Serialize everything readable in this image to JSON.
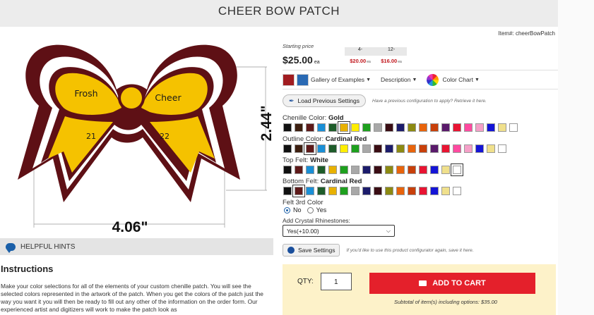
{
  "page_title": "CHEER BOW PATCH",
  "item_number": "Item#: cheerBowPatch",
  "artwork": {
    "labels": [
      "Frosh",
      "Cheer",
      "21",
      "22"
    ],
    "width_dim": "4.06\"",
    "height_dim": "2.44\""
  },
  "hints": {
    "label": "HELPFUL HINTS",
    "icon": "chat-bubble-icon"
  },
  "instructions": {
    "heading": "Instructions",
    "body": "Make your color selections for all of the elements of your custom chenille patch. You will see the selected colors represented in the artwork of the patch. When you get the colors of the patch just the way you want it you will then be ready to fill out any other of the information on the order form. Our experienced artist and digitizers will work to make the patch look as"
  },
  "pricing": {
    "starting_label": "Starting price",
    "price": "$25.00",
    "unit": "ea",
    "tiers": [
      {
        "qty": "4-",
        "price": "$20.00",
        "unit": "ea"
      },
      {
        "qty": "12-",
        "price": "$16.00",
        "unit": "ea"
      }
    ]
  },
  "toolbar": {
    "gallery": "Gallery of Examples",
    "description": "Description",
    "color_chart": "Color Chart"
  },
  "load_settings": {
    "button": "Load Previous Settings",
    "hint": "Have a previous configuration to apply? Retrieve it here."
  },
  "options": [
    {
      "label": "Chenille Color: ",
      "value": "Gold",
      "colors": [
        "#111111",
        "#3d1f10",
        "#5e1a1a",
        "#1a8fd6",
        "#1e5c2a",
        "#e8b100",
        "#ffee00",
        "#1ea01e",
        "#a8a8a8",
        "#3a0d14",
        "#1c1c6b",
        "#8c8a12",
        "#e8640c",
        "#c8400a",
        "#5a1a6b",
        "#e81432",
        "#ff4aa0",
        "#f5a0c8",
        "#1414d6",
        "#f0e08c",
        "#ffffff"
      ],
      "selected": 5
    },
    {
      "label": "Outline Color: ",
      "value": "Cardinal Red",
      "colors": [
        "#111111",
        "#3d1f10",
        "#5e1a1a",
        "#1a8fd6",
        "#1e5c2a",
        "#ffee00",
        "#1ea01e",
        "#a8a8a8",
        "#3a0d14",
        "#1c1c6b",
        "#8c8a12",
        "#e8640c",
        "#c8400a",
        "#5a1a6b",
        "#e81432",
        "#ff4aa0",
        "#f5a0c8",
        "#1414d6",
        "#f0e08c",
        "#ffffff"
      ],
      "selected": 2
    },
    {
      "label": "Top Felt: ",
      "value": "White",
      "colors": [
        "#111111",
        "#5e1a1a",
        "#1a8fd6",
        "#1e5c2a",
        "#e8b100",
        "#1ea01e",
        "#a8a8a8",
        "#1c1c6b",
        "#3a0d14",
        "#8c8a12",
        "#e8640c",
        "#c8400a",
        "#e81432",
        "#1414d6",
        "#f0e08c",
        "#ffffff"
      ],
      "selected": 15
    },
    {
      "label": "Bottom Felt: ",
      "value": "Cardinal Red",
      "colors": [
        "#111111",
        "#5e1a1a",
        "#1a8fd6",
        "#1e5c2a",
        "#e8b100",
        "#1ea01e",
        "#a8a8a8",
        "#1c1c6b",
        "#3a0d14",
        "#8c8a12",
        "#e8640c",
        "#c8400a",
        "#e81432",
        "#1414d6",
        "#f0e08c",
        "#ffffff"
      ],
      "selected": 1
    }
  ],
  "felt3": {
    "label": "Felt 3rd Color",
    "no": "No",
    "yes": "Yes"
  },
  "rhinestones": {
    "label": "Add Crystal Rhinestones:",
    "value": "Yes(+10.00)"
  },
  "save": {
    "button": "Save Settings",
    "hint": "If you'd like to use this product configurator again, save it here."
  },
  "cart": {
    "qty_label": "QTY:",
    "qty_value": "1",
    "add_label": "ADD TO CART",
    "subtotal": "Subtotal of item(s) including options: $35.00"
  }
}
